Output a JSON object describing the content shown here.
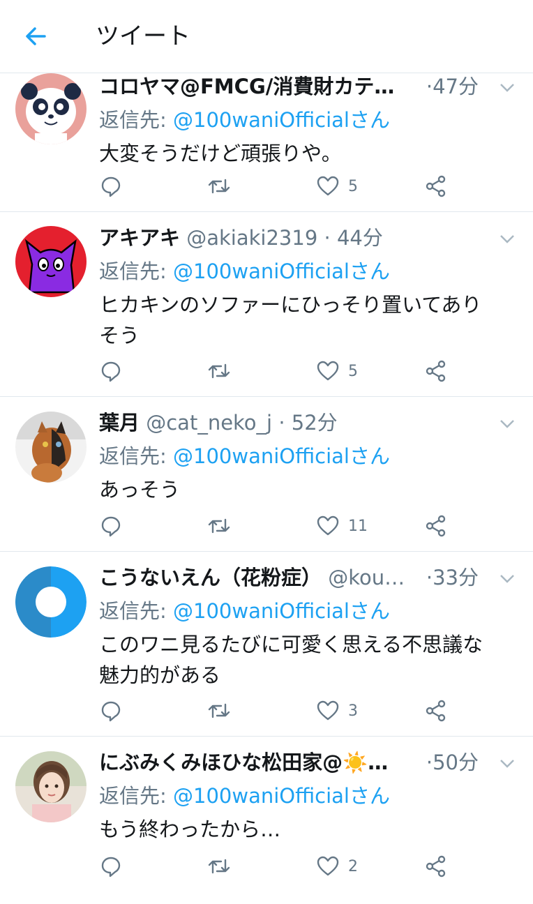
{
  "header": {
    "title": "ツイート"
  },
  "reply_prefix": "返信先:",
  "tweets": [
    {
      "name": "コロヤマ@FMCG/消費財カテ…",
      "handle": "",
      "time": "47分",
      "reply_to": "@100waniOfficialさん",
      "text": [
        "大変そうだけど頑張りや。"
      ],
      "likes": "5",
      "avatar": "panda"
    },
    {
      "name": "アキアキ",
      "handle": "@akiaki2319",
      "time": "44分",
      "reply_to": "@100waniOfficialさん",
      "text": [
        "ヒカキンのソファーにひっそり置いてあり",
        "そう"
      ],
      "likes": "5",
      "avatar": "purple-cat"
    },
    {
      "name": "葉月",
      "handle": "@cat_neko_j",
      "time": "52分",
      "reply_to": "@100waniOfficialさん",
      "text": [
        "あっそう"
      ],
      "likes": "11",
      "avatar": "cat-photo"
    },
    {
      "name": "こうないえん（花粉症）",
      "handle": "@kou…",
      "time": "33分",
      "reply_to": "@100waniOfficialさん",
      "text": [
        "このワニ見るたびに可愛く思える不思議な",
        "魅力的がある"
      ],
      "likes": "3",
      "avatar": "blue-donut"
    },
    {
      "name": "にぶみくみほひな松田家@☀️…",
      "handle": "",
      "time": "50分",
      "reply_to": "@100waniOfficialさん",
      "text": [
        "もう終わったから…"
      ],
      "likes": "2",
      "avatar": "girl-photo"
    }
  ],
  "colors": {
    "accent": "#1da1f2",
    "secondary": "#657786",
    "divider": "#e1e8ed"
  }
}
